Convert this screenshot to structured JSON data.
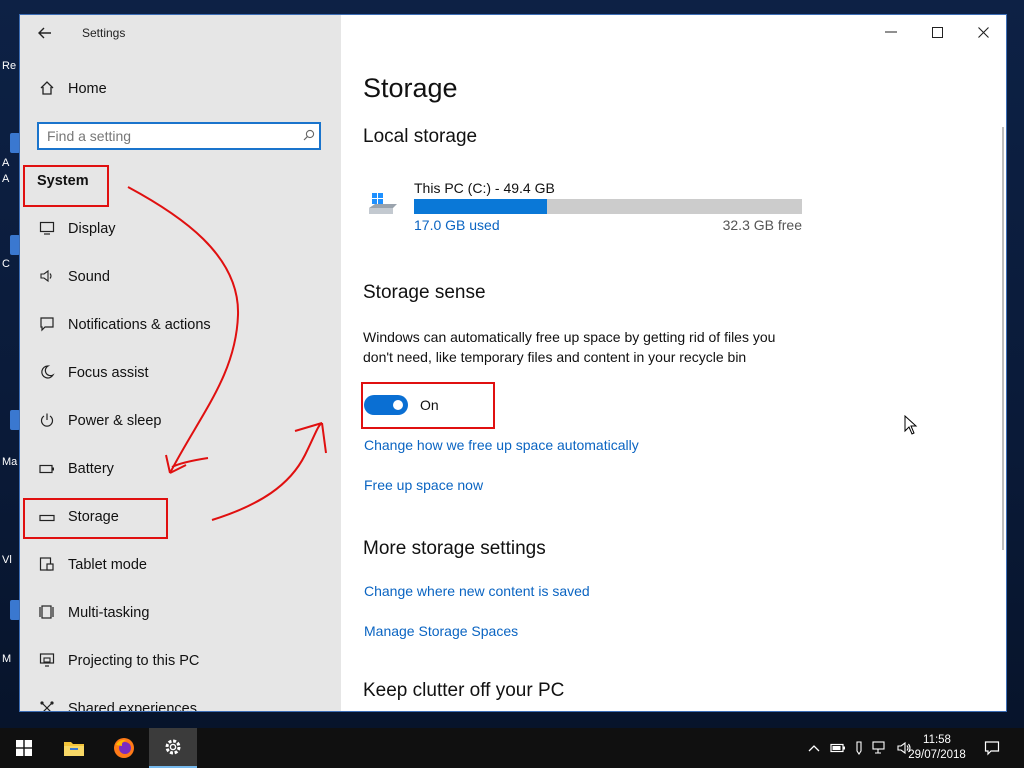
{
  "desktop": {
    "fragments": [
      "Re",
      "A",
      "A",
      "C",
      "Ma",
      "Vl",
      "M"
    ]
  },
  "window": {
    "app_title": "Settings",
    "controls": {
      "minimize": "—",
      "maximize": "☐",
      "close": "✕"
    }
  },
  "sidebar": {
    "home_label": "Home",
    "search_placeholder": "Find a setting",
    "section_label": "System",
    "items": [
      {
        "label": "Display",
        "icon": "display-icon"
      },
      {
        "label": "Sound",
        "icon": "speaker-icon"
      },
      {
        "label": "Notifications & actions",
        "icon": "notification-icon"
      },
      {
        "label": "Focus assist",
        "icon": "moon-icon"
      },
      {
        "label": "Power & sleep",
        "icon": "power-icon"
      },
      {
        "label": "Battery",
        "icon": "battery-icon"
      },
      {
        "label": "Storage",
        "icon": "storage-icon"
      },
      {
        "label": "Tablet mode",
        "icon": "tablet-icon"
      },
      {
        "label": "Multi-tasking",
        "icon": "multitask-icon"
      },
      {
        "label": "Projecting to this PC",
        "icon": "projecting-icon"
      },
      {
        "label": "Shared experiences",
        "icon": "shared-icon"
      }
    ]
  },
  "content": {
    "page_title": "Storage",
    "local_storage_heading": "Local storage",
    "drive": {
      "name": "This PC (C:) - 49.4 GB",
      "used_label": "17.0 GB used",
      "free_label": "32.3 GB free",
      "used_fraction": 0.344
    },
    "storage_sense_heading": "Storage sense",
    "storage_sense_desc": "Windows can automatically free up space by getting rid of files you don't need, like temporary files and content in your recycle bin",
    "toggle_label": "On",
    "link_change_free_space": "Change how we free up space automatically",
    "link_free_up_now": "Free up space now",
    "more_heading": "More storage settings",
    "link_change_location": "Change where new content is saved",
    "link_manage_spaces": "Manage Storage Spaces",
    "clutter_heading": "Keep clutter off your PC"
  },
  "taskbar": {
    "clock_time": "11:58",
    "clock_date": "29/07/2018"
  },
  "colors": {
    "accent": "#0a78d7",
    "link": "#0a64c2",
    "annotation": "#e01010"
  }
}
